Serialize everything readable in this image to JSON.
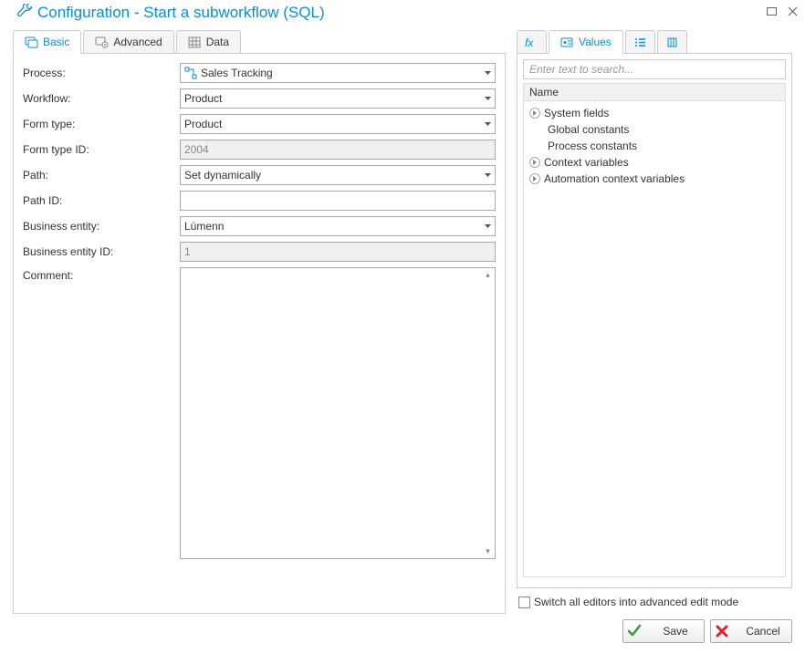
{
  "window": {
    "title": "Configuration - Start a subworkflow (SQL)"
  },
  "left_tabs": [
    {
      "label": "Basic",
      "active": true
    },
    {
      "label": "Advanced",
      "active": false
    },
    {
      "label": "Data",
      "active": false
    }
  ],
  "form": {
    "process": {
      "label": "Process:",
      "value": "Sales Tracking"
    },
    "workflow": {
      "label": "Workflow:",
      "value": "Product"
    },
    "form_type": {
      "label": "Form type:",
      "value": "Product"
    },
    "form_type_id": {
      "label": "Form type ID:",
      "value": "2004"
    },
    "path": {
      "label": "Path:",
      "value": "Set dynamically"
    },
    "path_id": {
      "label": "Path ID:",
      "value": ""
    },
    "business_entity": {
      "label": "Business entity:",
      "value": "Lúmenn"
    },
    "business_entity_id": {
      "label": "Business entity ID:",
      "value": "1"
    },
    "comment": {
      "label": "Comment:",
      "value": ""
    }
  },
  "right_tabs": [
    {
      "label": "",
      "kind": "fx",
      "active": false
    },
    {
      "label": "Values",
      "kind": "values",
      "active": true
    },
    {
      "label": "",
      "kind": "list",
      "active": false
    },
    {
      "label": "",
      "kind": "fields",
      "active": false
    }
  ],
  "search": {
    "placeholder": "Enter text to search..."
  },
  "tree": {
    "header": "Name",
    "items": [
      {
        "label": "System fields",
        "level": 0,
        "expandable": true
      },
      {
        "label": "Global constants",
        "level": 1
      },
      {
        "label": "Process constants",
        "level": 1
      },
      {
        "label": "Context variables",
        "level": 0,
        "expandable": true
      },
      {
        "label": "Automation context variables",
        "level": 0,
        "expandable": true
      }
    ]
  },
  "advanced_mode": {
    "label": "Switch all editors into advanced edit mode",
    "checked": false
  },
  "buttons": {
    "save": "Save",
    "cancel": "Cancel"
  }
}
